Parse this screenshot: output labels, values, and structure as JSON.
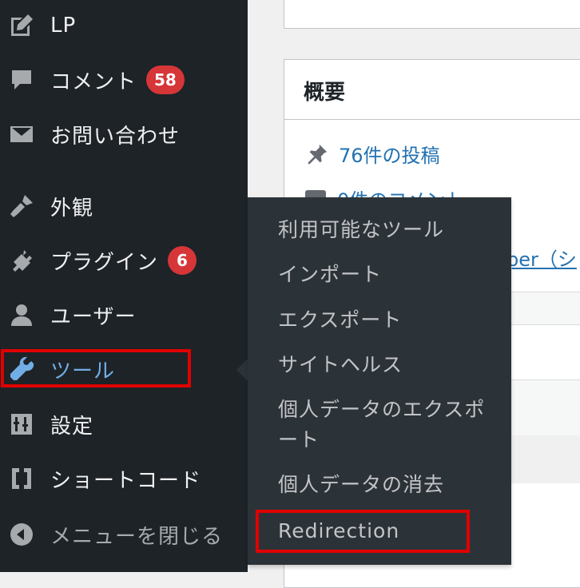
{
  "sidebar": {
    "items": [
      {
        "label": "LP",
        "icon": "edit-page-icon"
      },
      {
        "label": "コメント",
        "icon": "comment-bubble-icon",
        "badge": "58"
      },
      {
        "label": "お問い合わせ",
        "icon": "envelope-icon"
      },
      {
        "label": "外観",
        "icon": "paintbrush-icon"
      },
      {
        "label": "プラグイン",
        "icon": "plug-icon",
        "badge": "6"
      },
      {
        "label": "ユーザー",
        "icon": "user-icon"
      },
      {
        "label": "ツール",
        "icon": "wrench-icon",
        "current": true
      },
      {
        "label": "設定",
        "icon": "settings-sliders-icon"
      },
      {
        "label": "ショートコード",
        "icon": "shortcode-brackets-icon"
      },
      {
        "label": "メニューを閉じる",
        "icon": "collapse-arrow-icon"
      }
    ]
  },
  "submenu": {
    "items": [
      "利用可能なツール",
      "インポート",
      "エクスポート",
      "サイトヘルス",
      "個人データのエクスポート",
      "個人データの消去",
      "Redirection"
    ]
  },
  "panel": {
    "title": "概要",
    "posts_link": "76件の投稿",
    "comments_link": "0件のコメント",
    "partial_link": "per（シ"
  },
  "colors": {
    "sidebar_bg": "#1d2327",
    "flyout_bg": "#2c3338",
    "accent": "#72aee6",
    "badge": "#d63638",
    "highlight": "#e00000",
    "link": "#2271b1"
  }
}
